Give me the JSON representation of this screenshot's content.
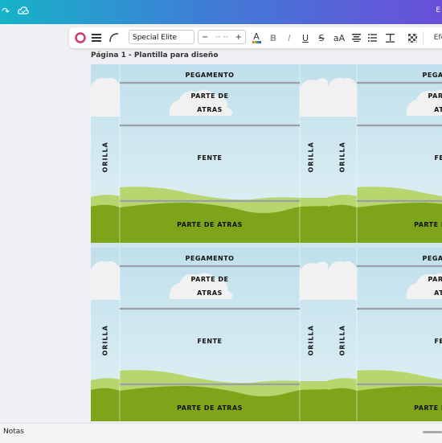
{
  "topbar": {
    "right_label": "E"
  },
  "toolbar": {
    "font_name": "Special Elite",
    "size_minus": "−",
    "size_value": "-- --",
    "size_plus": "+",
    "bold": "B",
    "italic": "I",
    "underline": "U",
    "strike": "S",
    "case": "aA",
    "effects_label": "Efe"
  },
  "page": {
    "label": "Página 1 - Plantilla para diseño"
  },
  "tile": {
    "top_label": "PEGAMENTO",
    "back_label_1": "PARTE DE",
    "back_label_2": "ATRAS",
    "front_label": "FENTE",
    "bottom_label": "PARTE DE ATRAS",
    "side_label": "ORILLA"
  },
  "bottom": {
    "notes_label": "Notas"
  },
  "colors": {
    "sky": "#cfe6ef",
    "grass_dark": "#7ea51a",
    "grass_light": "#b7d66e",
    "cloud": "#f1f1f1",
    "line": "#9aa0a6"
  }
}
